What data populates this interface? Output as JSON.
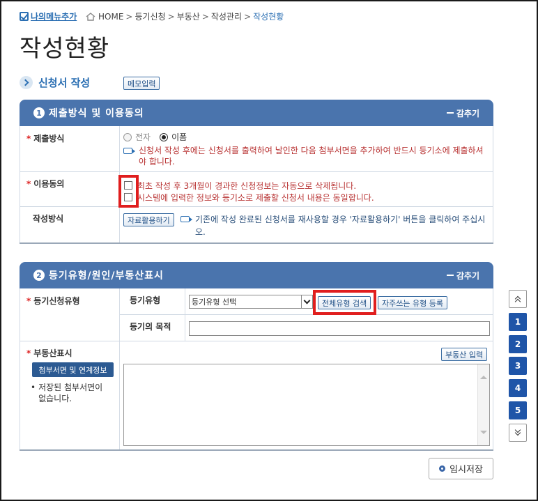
{
  "topbar": {
    "my_menu_label": "나의메뉴추가",
    "breadcrumb": [
      "HOME",
      "등기신청",
      "부동산",
      "작성관리",
      "작성현황"
    ],
    "breadcrumb_sep": ">"
  },
  "page_title": "작성현황",
  "section": {
    "title": "신청서 작성",
    "memo_button": "메모입력"
  },
  "panel1": {
    "number": "1",
    "title": "제출방식 및 이용동의",
    "collapse_label": "감추기",
    "submit_method": {
      "label": "제출방식",
      "options": [
        "전자",
        "이폼"
      ],
      "selected": "이폼",
      "note": "신청서 작성 후에는 신청서를 출력하여 날인한 다음 첨부서면을 추가하여 반드시 등기소에 제출하셔야 합니다."
    },
    "consent": {
      "label": "이용동의",
      "items": [
        "최초 작성 후 3개월이 경과한 신청정보는 자동으로 삭제됩니다.",
        "시스템에 입력한 정보와 등기소로 제출할 신청서 내용은 동일합니다."
      ]
    },
    "write_method": {
      "label": "작성방식",
      "button": "자료활용하기",
      "note": "기존에 작성 완료된 신청서를 재사용할 경우 '자료활용하기' 버튼을 클릭하여 주십시오."
    }
  },
  "panel2": {
    "number": "2",
    "title": "등기유형/원인/부동산표시",
    "collapse_label": "감추기",
    "reg_type": {
      "label": "등기신청유형",
      "type_label": "등기유형",
      "select_value": "등기유형 선택",
      "search_all_button": "전체유형 검색",
      "favorite_button": "자주쓰는 유형 등록",
      "purpose_label": "등기의 목적",
      "purpose_value": ""
    },
    "property": {
      "label": "부동산표시",
      "attach_button": "첨부서면 및 연계정보",
      "no_attach_text": "저장된 첨부서면이 없습니다.",
      "input_button": "부동산 입력"
    }
  },
  "side_nav": [
    "1",
    "2",
    "3",
    "4",
    "5"
  ],
  "save_button": "임시저장",
  "colors": {
    "panel_header": "#4a74ad",
    "accent": "#2b6fb3",
    "highlight_red": "#e01e1e",
    "nav_button": "#1f55a8"
  }
}
